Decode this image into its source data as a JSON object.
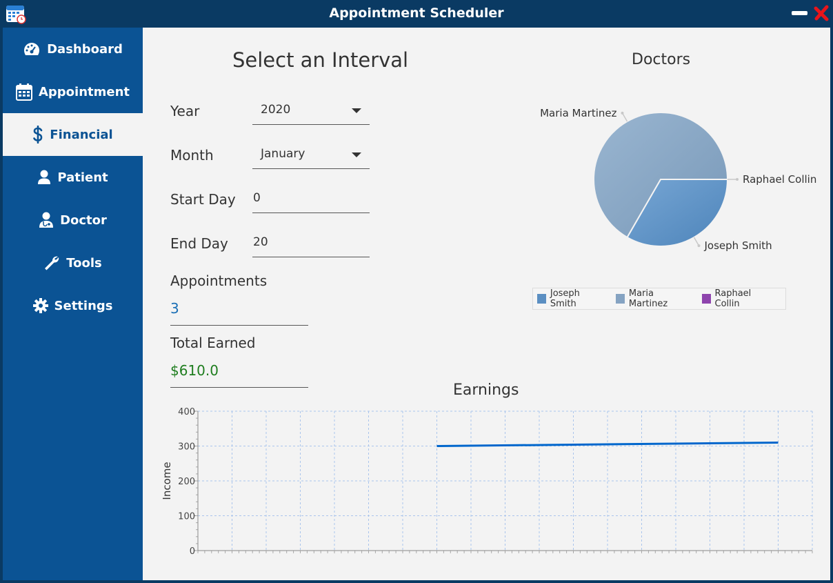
{
  "window": {
    "title": "Appointment Scheduler"
  },
  "sidebar": {
    "items": [
      {
        "label": "Dashboard",
        "icon": "dashboard-icon"
      },
      {
        "label": "Appointment",
        "icon": "calendar-icon"
      },
      {
        "label": "Financial",
        "icon": "dollar-icon",
        "active": true
      },
      {
        "label": "Patient",
        "icon": "user-icon"
      },
      {
        "label": "Doctor",
        "icon": "doctor-icon"
      },
      {
        "label": "Tools",
        "icon": "wrench-icon"
      },
      {
        "label": "Settings",
        "icon": "gear-icon"
      }
    ]
  },
  "interval": {
    "heading": "Select an Interval",
    "year_label": "Year",
    "year_value": "2020",
    "month_label": "Month",
    "month_value": "January",
    "start_label": "Start Day",
    "start_value": "0",
    "end_label": "End Day",
    "end_value": "20"
  },
  "stats": {
    "appointments_label": "Appointments",
    "appointments_value": "3",
    "earned_label": "Total Earned",
    "earned_value": "$610.0"
  },
  "colors": {
    "sidebar_bg": "#0b5394",
    "titlebar_bg": "#0a3a63",
    "appointments_value": "#1a6fb5",
    "earned_value": "#1e7d1e",
    "line": "#0066cc"
  },
  "chart_data": [
    {
      "type": "pie",
      "title": "Doctors",
      "slices": [
        {
          "name": "Joseph Smith",
          "value": 1,
          "color": "#5b8fc2"
        },
        {
          "name": "Maria Martinez",
          "value": 2,
          "color": "#85a3c2"
        },
        {
          "name": "Raphael Collin",
          "value": 0,
          "color": "#8e44ad"
        }
      ],
      "legend_position": "bottom"
    },
    {
      "type": "line",
      "title": "Earnings",
      "ylabel": "Income",
      "xlabel": "",
      "ylim": [
        0,
        400
      ],
      "yticks": [
        0,
        100,
        200,
        300,
        400
      ],
      "xlim": [
        0,
        18
      ],
      "grid": true,
      "series": [
        {
          "x": [
            7,
            17
          ],
          "values": [
            300,
            310
          ]
        }
      ]
    }
  ]
}
